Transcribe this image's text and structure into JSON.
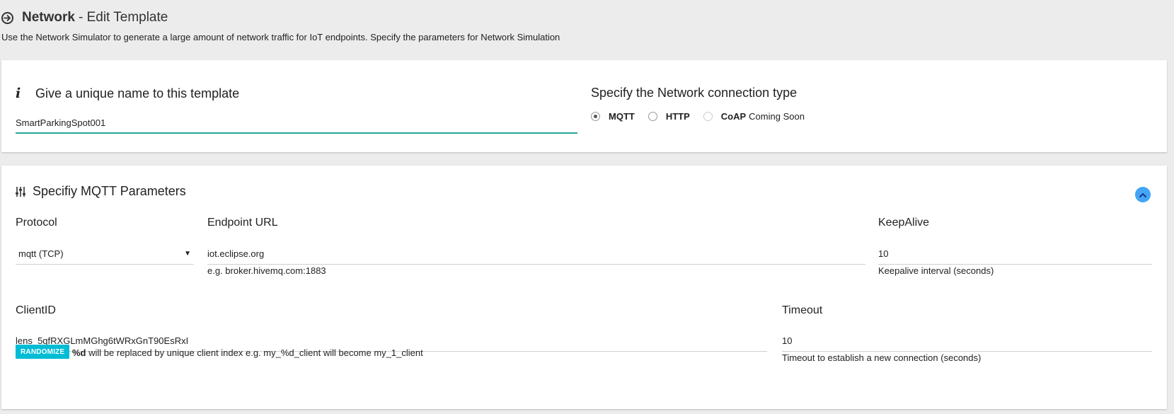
{
  "header": {
    "title_strong": "Network",
    "title_rest": "- Edit Template",
    "subtitle": "Use the Network Simulator to generate a large amount of network traffic for IoT endpoints. Specify the parameters for Network Simulation"
  },
  "template_name": {
    "heading": "Give a unique name to this template",
    "value": "SmartParkingSpot001"
  },
  "connection": {
    "heading": "Specify the Network connection type",
    "options": [
      {
        "label": "MQTT",
        "checked": true
      },
      {
        "label": "HTTP",
        "checked": false
      },
      {
        "label": "CoAP",
        "extra": "Coming Soon",
        "disabled": true
      }
    ]
  },
  "mqtt": {
    "heading": "Specifiy MQTT Parameters",
    "protocol": {
      "label": "Protocol",
      "value": "mqtt (TCP)"
    },
    "endpoint": {
      "label": "Endpoint URL",
      "value": "iot.eclipse.org",
      "hint": "e.g. broker.hivemq.com:1883"
    },
    "keepalive": {
      "label": "KeepAlive",
      "value": "10",
      "hint": "Keepalive interval (seconds)"
    },
    "clientid": {
      "label": "ClientID",
      "value": "lens_5qfRXGLmMGhg6tWRxGnT90EsRxI",
      "randomize_label": "RANDOMIZE",
      "hint_bold": "%d",
      "hint_rest": "will be replaced by unique client index e.g. my_%d_client will become my_1_client"
    },
    "timeout": {
      "label": "Timeout",
      "value": "10",
      "hint": "Timeout to establish a new connection (seconds)"
    }
  },
  "colors": {
    "accent_input": "#26a69a",
    "collapse_button": "#42a5f5",
    "randomize_button": "#00bcd4"
  }
}
